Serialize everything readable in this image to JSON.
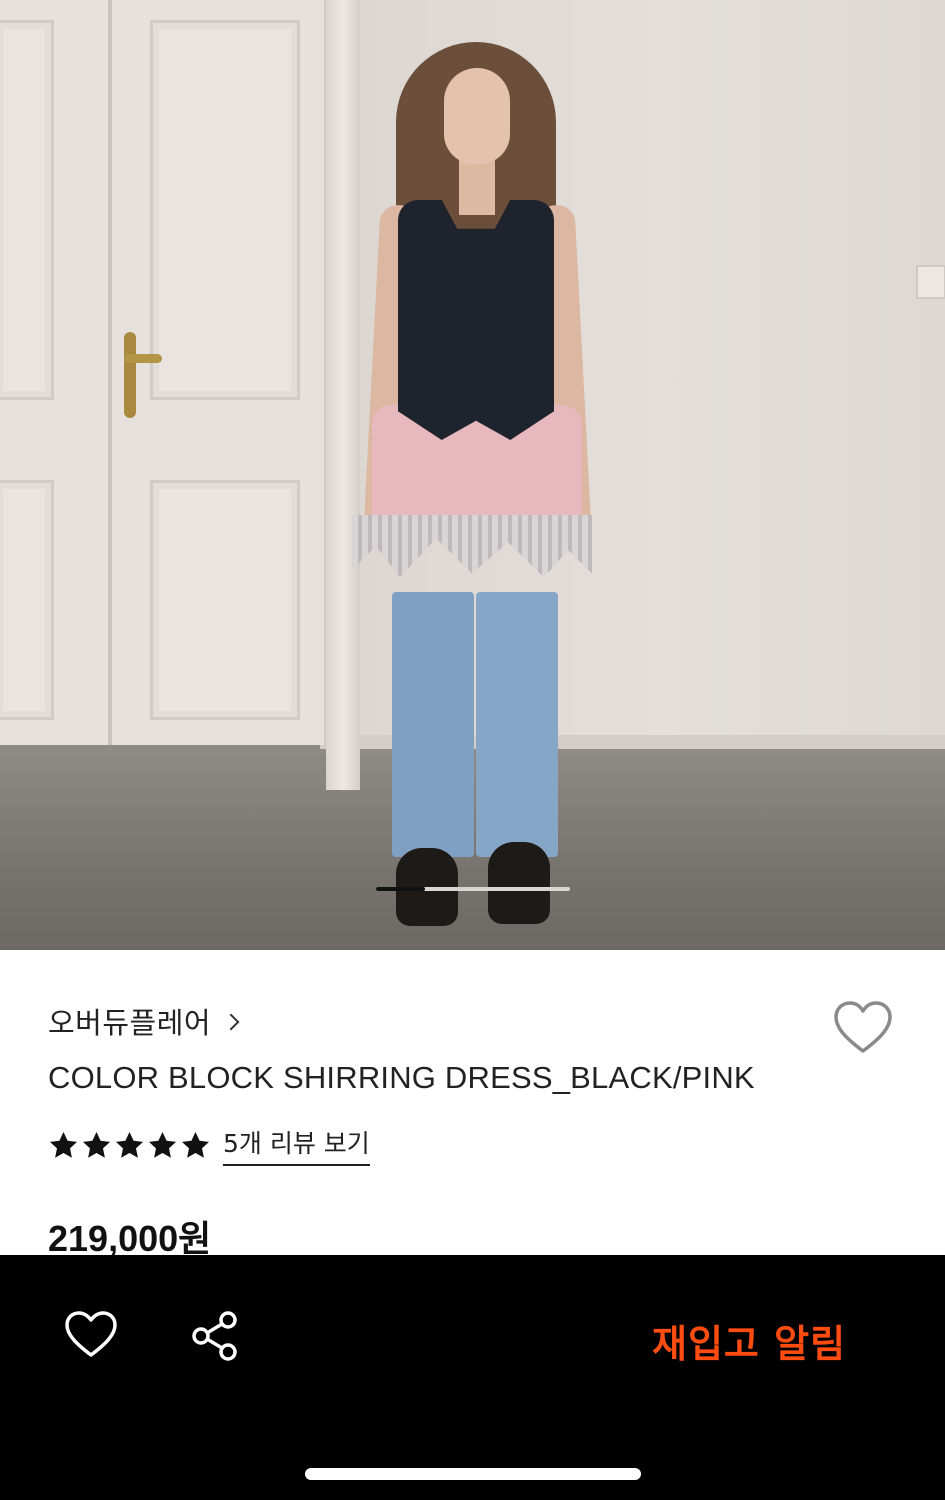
{
  "gallery": {
    "image_alt": "",
    "current_index": 1,
    "total": 4
  },
  "product": {
    "brand": "오버듀플레어",
    "title": "COLOR BLOCK SHIRRING DRESS_BLACK/PINK",
    "rating": 5,
    "review_link": "5개 리뷰 보기",
    "price": "219,000원"
  },
  "bottom_bar": {
    "restock_label": "재입고 알림"
  },
  "icons": {
    "wishlist": "heart-outline-icon",
    "share": "share-icon",
    "brand_arrow": "chevron-right-icon",
    "star": "star-filled-icon"
  },
  "colors": {
    "accent": "#ff4d12",
    "bar_background": "#000000",
    "text": "#222222"
  }
}
